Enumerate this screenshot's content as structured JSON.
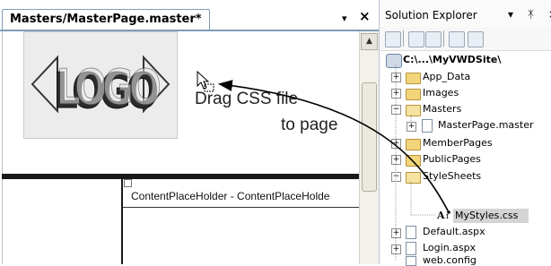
{
  "editor": {
    "tab_title": "Masters/MasterPage.master*",
    "dropdown_glyph": "▾",
    "close_glyph": "×",
    "scroll_up_glyph": "▲",
    "drag_line1": "Drag CSS file",
    "drag_line2": "to page",
    "content_placeholder": "ContentPlaceHolder - ContentPlaceHolde"
  },
  "logo": {
    "text": "LOGO",
    "colors": {
      "dark": "#2b2b2b",
      "light": "#e9e9e9"
    }
  },
  "solution_explorer": {
    "title": "Solution Explorer",
    "controls": "▾ ᛡ ×",
    "root": "C:\\...\\MyVWDSite\\",
    "items": [
      {
        "label": "App_Data",
        "type": "folder",
        "state": "collapsed"
      },
      {
        "label": "Images",
        "type": "folder",
        "state": "collapsed"
      },
      {
        "label": "Masters",
        "type": "folder",
        "state": "expanded"
      },
      {
        "label": "MasterPage.master",
        "type": "file",
        "state": "collapsed"
      },
      {
        "label": "MemberPages",
        "type": "folder",
        "state": "collapsed"
      },
      {
        "label": "PublicPages",
        "type": "folder",
        "state": "collapsed"
      },
      {
        "label": "StyleSheets",
        "type": "folder",
        "state": "expanded"
      },
      {
        "label": "MyStyles.css",
        "type": "css-file",
        "state": "selected"
      },
      {
        "label": "Default.aspx",
        "type": "file",
        "state": "collapsed"
      },
      {
        "label": "Login.aspx",
        "type": "file",
        "state": "collapsed"
      },
      {
        "label": "web.config",
        "type": "file",
        "state": "none"
      }
    ]
  },
  "icons": {
    "cursor": "drag-cursor-icon",
    "arrow": "curved-drag-arrow"
  },
  "colors": {
    "highlight": "#cde3ef",
    "accent_border": "#7f9db9",
    "folder": "#f2d47a"
  }
}
